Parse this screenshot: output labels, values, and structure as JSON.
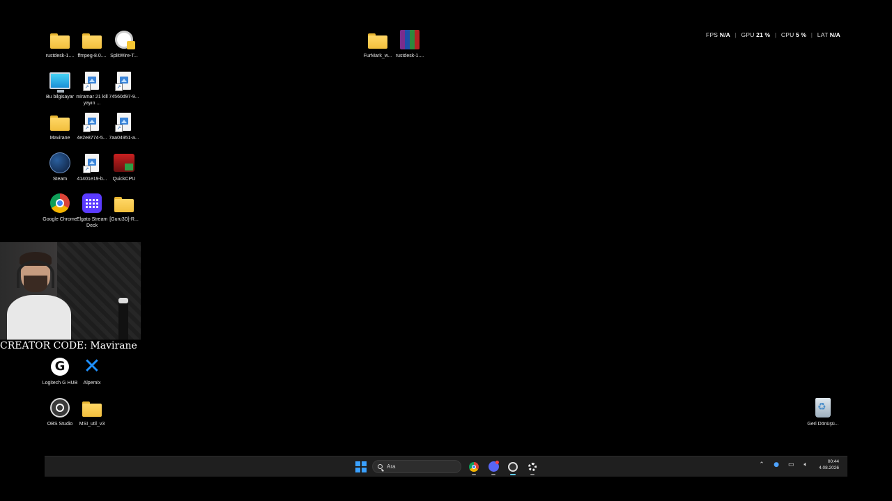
{
  "desktop_icons": [
    {
      "label": "rustdesk-1...."
    },
    {
      "label": "ffmpeg-8.0...."
    },
    {
      "label": "SplitWire-T..."
    },
    {
      "label": "Bu bilgisayar"
    },
    {
      "label": "miramar 21 kill yayın ..."
    },
    {
      "label": "74560d97-9..."
    },
    {
      "label": "Mavirane"
    },
    {
      "label": "4e2e8774-5..."
    },
    {
      "label": "7aa04951-a..."
    },
    {
      "label": "Steam"
    },
    {
      "label": "41401e19-b..."
    },
    {
      "label": "QuickCPU"
    },
    {
      "label": "Google Chrome"
    },
    {
      "label": "Elgato Stream Deck"
    },
    {
      "label": "[Guru3D]-R..."
    },
    {
      "label": "Logitech G HUB"
    },
    {
      "label": "Alpemix"
    },
    {
      "label": "OBS Studio"
    },
    {
      "label": "MSI_util_v3"
    },
    {
      "label": "FurMark_w..."
    },
    {
      "label": "rustdesk-1...."
    },
    {
      "label": "Geri Dönüşü..."
    }
  ],
  "performance_overlay": {
    "fps_label": "FPS",
    "fps_value": "N/A",
    "gpu_label": "GPU",
    "gpu_value": "21 %",
    "cpu_label": "CPU",
    "cpu_value": "5 %",
    "lat_label": "LAT",
    "lat_value": "N/A"
  },
  "creator_code_text": "CREATOR CODE: Mavirane",
  "taskbar": {
    "search_placeholder": "Ara",
    "time": "00:44",
    "date": "4.08.2026"
  },
  "colors": {
    "folder": "#ffd766",
    "taskbar_bg": "#1f1f1f",
    "accent": "#60cdff"
  }
}
